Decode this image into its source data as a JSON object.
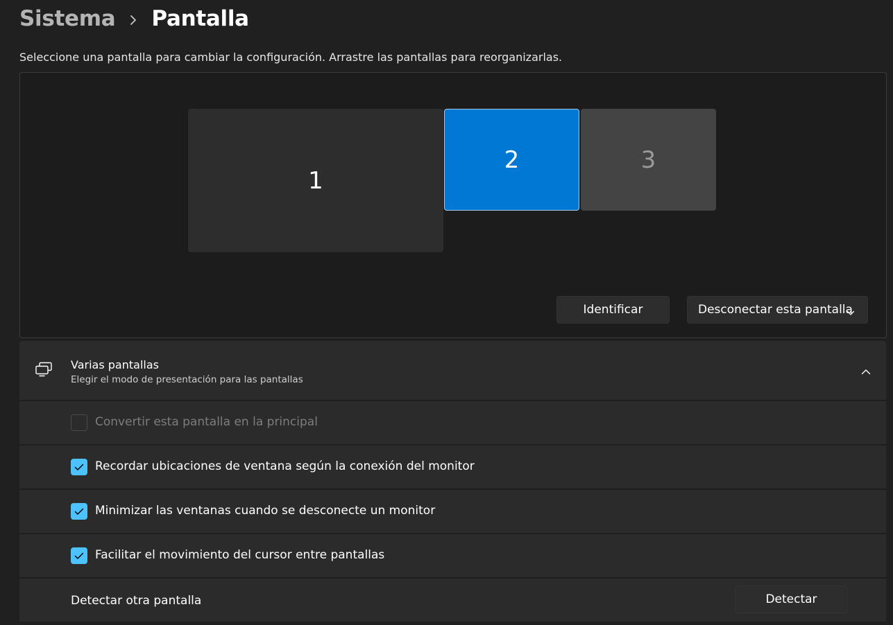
{
  "breadcrumb": {
    "parent": "Sistema",
    "current": "Pantalla"
  },
  "instruction": "Seleccione una pantalla para cambiar la configuración. Arrastre las pantallas para reorganizarlas.",
  "monitors": [
    {
      "label": "1",
      "selected": false
    },
    {
      "label": "2",
      "selected": true
    },
    {
      "label": "3",
      "selected": false
    }
  ],
  "arrangement_buttons": {
    "identify": "Identificar",
    "disconnect": "Desconectar esta pantalla"
  },
  "multiple_displays": {
    "title": "Varias pantallas",
    "subtitle": "Elegir el modo de presentación para las pantallas",
    "expanded": true,
    "options": [
      {
        "label": "Convertir esta pantalla en la principal",
        "checked": false,
        "disabled": true
      },
      {
        "label": "Recordar ubicaciones de ventana según la conexión del monitor",
        "checked": true,
        "disabled": false
      },
      {
        "label": "Minimizar las ventanas cuando se desconecte un monitor",
        "checked": true,
        "disabled": false
      },
      {
        "label": "Facilitar el movimiento del cursor entre pantallas",
        "checked": true,
        "disabled": false
      }
    ],
    "detect": {
      "label": "Detectar otra pantalla",
      "button": "Detectar"
    }
  },
  "colors": {
    "background": "#202020",
    "card": "#2b2b2b",
    "accent": "#0078d4",
    "checkbox": "#4cc2ff"
  },
  "icons": {
    "breadcrumb_separator": "chevron-right-icon",
    "disconnect_dropdown": "chevron-down-icon",
    "section": "multiple-displays-icon",
    "collapse": "chevron-up-icon",
    "check": "checkmark-icon"
  }
}
